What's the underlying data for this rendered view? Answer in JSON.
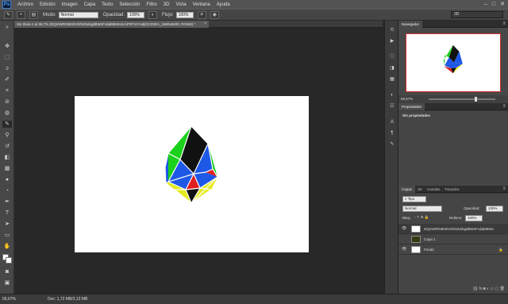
{
  "app": {
    "logo": "Ps"
  },
  "menu": [
    "Archivo",
    "Edición",
    "Imagen",
    "Capa",
    "Texto",
    "Selección",
    "Filtro",
    "3D",
    "Vista",
    "Ventana",
    "Ayuda"
  ],
  "window_controls": {
    "minimize": "–",
    "maximize": "□",
    "close": "✕"
  },
  "options_bar": {
    "mode_label": "Modo:",
    "mode_value": "Normal",
    "opacity_label": "Opacidad:",
    "opacity_value": "100%",
    "flow_label": "Flujo:",
    "flow_value": "100%",
    "workspace_value": "3D"
  },
  "document": {
    "tab_title": "Sin título-1 al 66,7% (DQmWRGBNhVNhSZwhgdBWsFcdab9Mmmc1P9TVAYxdjGCZSEA_1680x8400, RGB/8) *",
    "tab_close": "×"
  },
  "status": {
    "zoom": "66,67%",
    "doc_info": "Doc: 1,72 MB/3,13 MB"
  },
  "navigator": {
    "tab": "Navegador",
    "zoom": "66,67%"
  },
  "properties": {
    "tab": "Propiedades",
    "empty_text": "Sin propiedades"
  },
  "layers_panel": {
    "tabs": [
      "Capas",
      "3D",
      "Canales",
      "Trazados"
    ],
    "filter_label": "Tipo",
    "blend_mode": "Normal",
    "opacity_label": "Opacidad:",
    "opacity_value": "100%",
    "lock_label": "Bloq.:",
    "fill_label": "Relleno:",
    "fill_value": "100%",
    "layers": [
      {
        "name": "DQmWRGBNhVNhSZwhgdBWsFcdab9Mmmc..."
      },
      {
        "name": "Capa 1"
      },
      {
        "name": "Fondo"
      }
    ],
    "footer_icons": "⛓ fx ◙ ◐ ▭ ▢ 🗑"
  },
  "colors": {
    "accent_blue": "#1e58e6",
    "green": "#1bd11b",
    "red": "#e01f1f",
    "yellow": "#e4ea1f",
    "black": "#111111"
  }
}
